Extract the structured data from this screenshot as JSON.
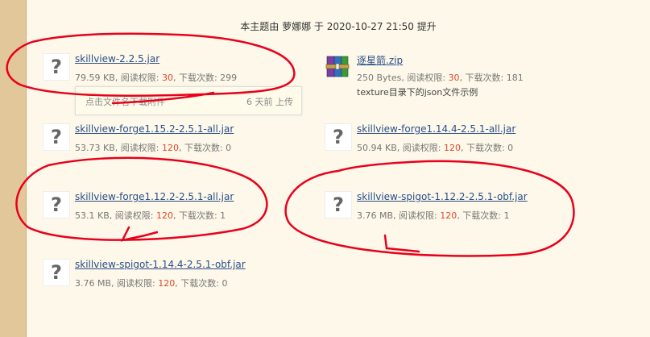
{
  "notice": "本主题由 萝娜娜 于 2020-10-27 21:50 提升",
  "tooltip": {
    "left": "点击文件名下载附件",
    "right": "6 天前 上传"
  },
  "attachments": [
    {
      "name": "skillview-2.2.5.jar",
      "size": "79.59 KB, 阅读权限: ",
      "perm": "30",
      "dl_label": ", 下载次数: ",
      "dl": "299",
      "icon": "unknown-file-icon"
    },
    {
      "name": "逐星箭.zip",
      "size": "250 Bytes, 阅读权限: ",
      "perm": "30",
      "dl_label": ", 下载次数: ",
      "dl": "181",
      "desc": "texture目录下的json文件示例",
      "icon": "winrar-archive-icon"
    },
    {
      "name": "skillview-forge1.15.2-2.5.1-all.jar",
      "size": "53.73 KB, 阅读权限: ",
      "perm": "120",
      "dl_label": ", 下载次数: ",
      "dl": "0",
      "icon": "unknown-file-icon"
    },
    {
      "name": "skillview-forge1.14.4-2.5.1-all.jar",
      "size": "50.94 KB, 阅读权限: ",
      "perm": "120",
      "dl_label": ", 下载次数: ",
      "dl": "0",
      "icon": "unknown-file-icon"
    },
    {
      "name": "skillview-forge1.12.2-2.5.1-all.jar",
      "size": "53.1 KB, 阅读权限: ",
      "perm": "120",
      "dl_label": ", 下载次数: ",
      "dl": "1",
      "icon": "unknown-file-icon"
    },
    {
      "name": "skillview-spigot-1.12.2-2.5.1-obf.jar",
      "size": "3.76 MB, 阅读权限: ",
      "perm": "120",
      "dl_label": ", 下载次数: ",
      "dl": "1",
      "icon": "unknown-file-icon"
    },
    {
      "name": "skillview-spigot-1.14.4-2.5.1-obf.jar",
      "size": "3.76 MB, 阅读权限: ",
      "perm": "120",
      "dl_label": ", 下载次数: ",
      "dl": "0",
      "icon": "unknown-file-icon"
    }
  ],
  "unknown_icon_glyph": "?",
  "colors": {
    "perm_red": "#e0472d",
    "link_blue": "#2a4f8a",
    "annotation_red": "#e8001c",
    "background": "#fdf8e9"
  }
}
